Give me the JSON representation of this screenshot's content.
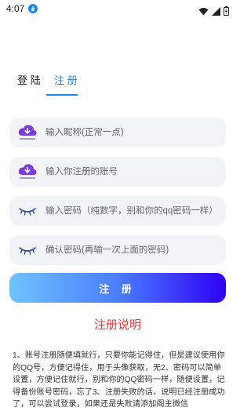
{
  "status_bar": {
    "time": "4:07"
  },
  "tabs": {
    "login": "登 陆",
    "register": "注 册"
  },
  "fields": {
    "nickname": {
      "placeholder": "输入昵称(正常一点)",
      "icon": "cloud-download-icon"
    },
    "account": {
      "placeholder": "输入你注册的账号",
      "icon": "cloud-download-icon"
    },
    "password": {
      "placeholder": "输入密码（纯数字，别和你的qq密码一样）",
      "icon": "closed-eye-icon"
    },
    "confirm_password": {
      "placeholder": "确认密码(再输一次上面的密码)",
      "icon": "closed-eye-icon"
    }
  },
  "register_button": "注 册",
  "help": {
    "title": "注册说明",
    "text": "1、账号注册随便填就行，只要你能记得住，但是建议使用你的QQ号，方便记得住，用于头像获取，无2、密码可以简单设置，方便记住就行，别和你的QQ密码一样，随便设置，记得备份账号密码，忘了3、注册失败的话，说明已经注册成功了，可以尝试登录，如果还是失败请添加阁主微信"
  },
  "colors": {
    "accent": "#1e88e5",
    "danger": "#e53935",
    "button_gradient_start": "#6fc3ff",
    "button_gradient_end": "#2f00f5",
    "field_bg": "#f2f3f6",
    "icon_purple": "#7b3fd1"
  }
}
